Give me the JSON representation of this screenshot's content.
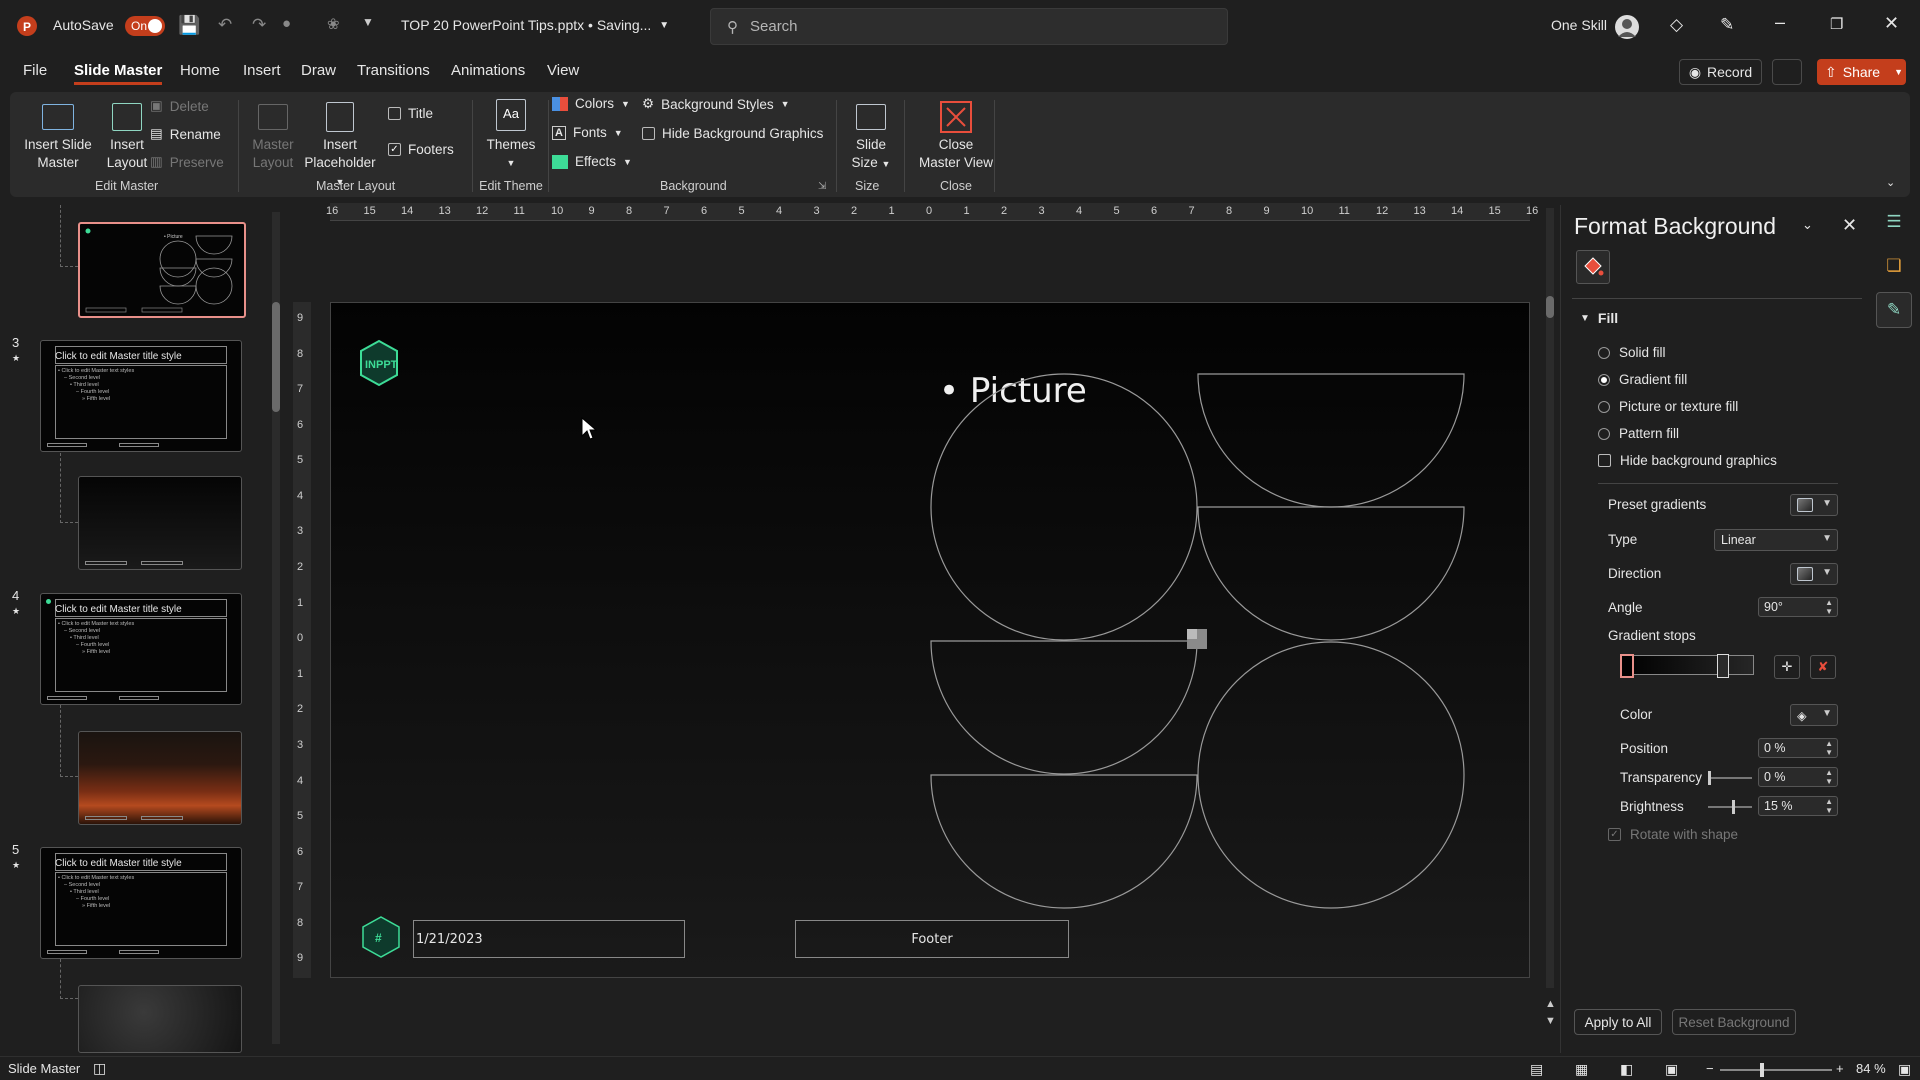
{
  "titlebar": {
    "autosave_label": "AutoSave",
    "autosave_state": "On",
    "filename": "TOP 20 PowerPoint Tips.pptx • Saving...",
    "search_placeholder": "Search",
    "user_name": "One Skill"
  },
  "tabs": [
    "File",
    "Slide Master",
    "Home",
    "Insert",
    "Draw",
    "Transitions",
    "Animations",
    "View"
  ],
  "buttons": {
    "record": "Record",
    "share": "Share"
  },
  "ribbon": {
    "insert_slide_master": [
      "Insert Slide",
      "Master"
    ],
    "insert_layout": [
      "Insert",
      "Layout"
    ],
    "delete": "Delete",
    "rename": "Rename",
    "preserve": "Preserve",
    "group_edit_master": "Edit Master",
    "master_layout": [
      "Master",
      "Layout"
    ],
    "insert_placeholder": [
      "Insert",
      "Placeholder"
    ],
    "title_cb": "Title",
    "footers_cb": "Footers",
    "group_master_layout": "Master Layout",
    "themes": "Themes",
    "group_edit_theme": "Edit Theme",
    "colors": "Colors",
    "fonts": "Fonts",
    "effects": "Effects",
    "background_styles": "Background Styles",
    "hide_background_graphics": "Hide Background Graphics",
    "group_background": "Background",
    "slide_size": [
      "Slide",
      "Size"
    ],
    "group_size": "Size",
    "close_master_view": [
      "Close",
      "Master View"
    ],
    "group_close": "Close"
  },
  "thumbnails": {
    "title_text": "Click to edit Master title style",
    "body_lines": [
      "• Click to edit Master text styles",
      "– Second level",
      "• Third level",
      "– Fourth level",
      "» Fifth level"
    ],
    "thumb2_text": "• Picture",
    "numbers": [
      "3",
      "4",
      "5"
    ]
  },
  "ruler": {
    "h_ticks": [
      "16",
      "15",
      "14",
      "13",
      "12",
      "11",
      "10",
      "9",
      "8",
      "7",
      "6",
      "5",
      "4",
      "3",
      "2",
      "1",
      "0",
      "1",
      "2",
      "3",
      "4",
      "5",
      "6",
      "7",
      "8",
      "9",
      "10",
      "11",
      "12",
      "13",
      "14",
      "15",
      "16"
    ],
    "v_ticks": [
      "9",
      "8",
      "7",
      "6",
      "5",
      "4",
      "3",
      "2",
      "1",
      "0",
      "1",
      "2",
      "3",
      "4",
      "5",
      "6",
      "7",
      "8",
      "9"
    ]
  },
  "slide": {
    "logo_text": "INPPT",
    "picture_bullet": "Picture",
    "date": "1/21/2023",
    "footer": "Footer",
    "small_logo": "#"
  },
  "pane": {
    "title": "Format Background",
    "section": "Fill",
    "fill_options": [
      "Solid fill",
      "Gradient fill",
      "Picture or texture fill",
      "Pattern fill"
    ],
    "selected_fill": "Gradient fill",
    "hide_bg": "Hide background graphics",
    "preset_gradients": "Preset gradients",
    "type_label": "Type",
    "type_value": "Linear",
    "direction": "Direction",
    "angle_label": "Angle",
    "angle_value": "90°",
    "gradient_stops": "Gradient stops",
    "color": "Color",
    "position_label": "Position",
    "position_value": "0 %",
    "transparency_label": "Transparency",
    "transparency_value": "0 %",
    "brightness_label": "Brightness",
    "brightness_value": "15 %",
    "rotate_with_shape": "Rotate with shape",
    "apply_all": "Apply to All",
    "reset_background": "Reset Background"
  },
  "status": {
    "mode": "Slide Master",
    "zoom": "84 %"
  },
  "colors": {
    "accent": "#c43e1c",
    "teal": "#3ddc97",
    "selection": "#e8908a"
  }
}
